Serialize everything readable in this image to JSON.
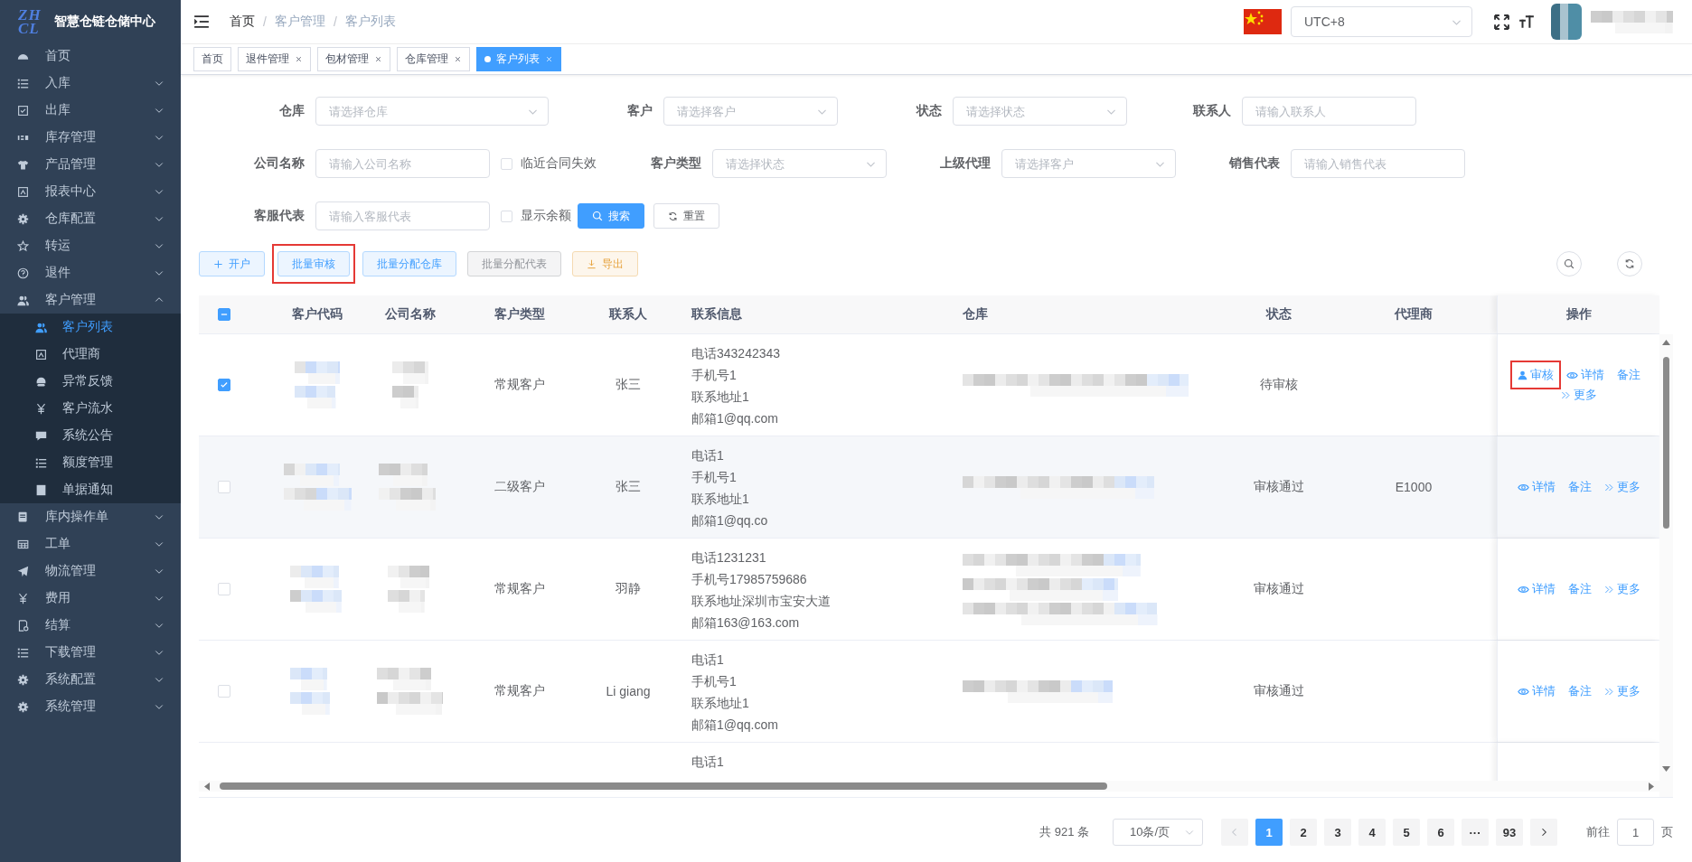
{
  "sidebar": {
    "logo_text": "ZHCL",
    "title": "智慧仓链仓储中心",
    "items": [
      {
        "label": "首页",
        "expandable": false,
        "selected": false
      },
      {
        "label": "入库",
        "expandable": true,
        "expanded": false,
        "selected": false
      },
      {
        "label": "出库",
        "expandable": true,
        "expanded": false,
        "selected": false
      },
      {
        "label": "库存管理",
        "expandable": true,
        "expanded": false,
        "selected": false
      },
      {
        "label": "产品管理",
        "expandable": true,
        "expanded": false,
        "selected": false
      },
      {
        "label": "报表中心",
        "expandable": true,
        "expanded": false,
        "selected": false
      },
      {
        "label": "仓库配置",
        "expandable": true,
        "expanded": false,
        "selected": false
      },
      {
        "label": "转运",
        "expandable": true,
        "expanded": false,
        "selected": false
      },
      {
        "label": "退件",
        "expandable": true,
        "expanded": false,
        "selected": false
      },
      {
        "label": "客户管理",
        "expandable": true,
        "expanded": true,
        "selected": false,
        "children": [
          {
            "label": "客户列表",
            "selected": true
          },
          {
            "label": "代理商",
            "selected": false
          },
          {
            "label": "异常反馈",
            "selected": false
          },
          {
            "label": "客户流水",
            "selected": false
          },
          {
            "label": "系统公告",
            "selected": false
          },
          {
            "label": "额度管理",
            "selected": false
          },
          {
            "label": "单据通知",
            "selected": false
          }
        ]
      },
      {
        "label": "库内操作单",
        "expandable": true,
        "expanded": false,
        "selected": false
      },
      {
        "label": "工单",
        "expandable": true,
        "expanded": false,
        "selected": false
      },
      {
        "label": "物流管理",
        "expandable": true,
        "expanded": false,
        "selected": false
      },
      {
        "label": "费用",
        "expandable": true,
        "expanded": false,
        "selected": false
      },
      {
        "label": "结算",
        "expandable": true,
        "expanded": false,
        "selected": false
      },
      {
        "label": "下载管理",
        "expandable": true,
        "expanded": false,
        "selected": false
      },
      {
        "label": "系统配置",
        "expandable": true,
        "expanded": false,
        "selected": false
      },
      {
        "label": "系统管理",
        "expandable": true,
        "expanded": false,
        "selected": false
      }
    ]
  },
  "header": {
    "separator": "/",
    "breadcrumb": [
      {
        "label": "首页",
        "link": true
      },
      {
        "label": "客户管理",
        "link": false
      },
      {
        "label": "客户列表",
        "link": false
      }
    ],
    "timezone": "UTC+8"
  },
  "tags": [
    {
      "label": "首页",
      "closable": false,
      "selected": false
    },
    {
      "label": "退件管理",
      "closable": true,
      "selected": false
    },
    {
      "label": "包材管理",
      "closable": true,
      "selected": false
    },
    {
      "label": "仓库管理",
      "closable": true,
      "selected": false
    },
    {
      "label": "客户列表",
      "closable": true,
      "selected": true
    }
  ],
  "filters": {
    "rows": [
      [
        {
          "kind": "select",
          "label": "仓库",
          "placeholder": "请选择仓库"
        },
        {
          "kind": "select",
          "label": "客户",
          "placeholder": "请选择客户"
        },
        {
          "kind": "select",
          "label": "状态",
          "placeholder": "请选择状态"
        },
        {
          "kind": "input",
          "label": "联系人",
          "placeholder": "请输入联系人"
        }
      ],
      [
        {
          "kind": "input",
          "label": "公司名称",
          "placeholder": "请输入公司名称",
          "checkbox": {
            "label": "临近合同失效",
            "checked": false
          }
        },
        {
          "kind": "select",
          "label": "客户类型",
          "placeholder": "请选择状态"
        },
        {
          "kind": "select",
          "label": "上级代理",
          "placeholder": "请选择客户"
        },
        {
          "kind": "input",
          "label": "销售代表",
          "placeholder": "请输入销售代表"
        }
      ],
      [
        {
          "kind": "input",
          "label": "客服代表",
          "placeholder": "请输入客服代表",
          "checkbox": {
            "label": "显示余额",
            "checked": false
          }
        },
        {
          "kind": "buttons",
          "buttons": [
            {
              "kind": "search",
              "label": "搜索"
            },
            {
              "kind": "reset",
              "label": "重置"
            }
          ]
        }
      ]
    ]
  },
  "toolbar": {
    "buttons": [
      {
        "kind": "create",
        "label": "开户",
        "highlighted": false
      },
      {
        "kind": "batch",
        "label": "批量审核",
        "highlighted": true
      },
      {
        "kind": "batch",
        "label": "批量分配仓库",
        "highlighted": false
      },
      {
        "kind": "muted",
        "label": "批量分配代表",
        "highlighted": false
      },
      {
        "kind": "export",
        "label": "导出",
        "highlighted": false
      }
    ]
  },
  "table": {
    "columns": [
      "客户代码",
      "公司名称",
      "客户类型",
      "联系人",
      "联系信息",
      "仓库",
      "状态",
      "代理商",
      "操作"
    ],
    "select_all": {
      "indeterminate": true
    },
    "rows": [
      {
        "selected": true,
        "hovered": false,
        "blurred": true,
        "type": "常规客户",
        "contact": "张三",
        "contact_info": [
          "电话343242343",
          "手机号1",
          "联系地址1",
          "邮箱1@qq.com"
        ],
        "status": "待审核",
        "actions": [
          {
            "kind": "audit",
            "label": "审核",
            "highlighted": true
          },
          {
            "kind": "detail",
            "label": "详情",
            "highlighted": false
          },
          {
            "kind": "note",
            "label": "备注",
            "highlighted": false
          },
          {
            "kind": "more",
            "label": "更多",
            "highlighted": false
          }
        ]
      },
      {
        "selected": false,
        "hovered": true,
        "blurred": true,
        "type": "二级客户",
        "contact": "张三",
        "contact_info": [
          "电话1",
          "手机号1",
          "联系地址1",
          "邮箱1@qq.co"
        ],
        "status": "审核通过",
        "agent": "E1000",
        "actions": [
          {
            "kind": "detail",
            "label": "详情",
            "highlighted": false
          },
          {
            "kind": "note",
            "label": "备注",
            "highlighted": false
          },
          {
            "kind": "more",
            "label": "更多",
            "highlighted": false
          }
        ]
      },
      {
        "selected": false,
        "hovered": false,
        "blurred": true,
        "type": "常规客户",
        "contact": "羽静",
        "contact_info": [
          "电话1231231",
          "手机号17985759686",
          "联系地址深圳市宝安大道",
          "邮箱163@163.com"
        ],
        "status": "审核通过",
        "actions": [
          {
            "kind": "detail",
            "label": "详情",
            "highlighted": false
          },
          {
            "kind": "note",
            "label": "备注",
            "highlighted": false
          },
          {
            "kind": "more",
            "label": "更多",
            "highlighted": false
          }
        ]
      },
      {
        "selected": false,
        "hovered": false,
        "blurred": true,
        "type": "常规客户",
        "contact": "Li giang",
        "contact_info": [
          "电话1",
          "手机号1",
          "联系地址1",
          "邮箱1@qq.com"
        ],
        "status": "审核通过",
        "actions": [
          {
            "kind": "detail",
            "label": "详情",
            "highlighted": false
          },
          {
            "kind": "note",
            "label": "备注",
            "highlighted": false
          },
          {
            "kind": "more",
            "label": "更多",
            "highlighted": false
          }
        ]
      },
      {
        "contact_info": [
          "电话1"
        ]
      }
    ]
  },
  "pagination": {
    "total": "共 921 条",
    "page_size": "10条/页",
    "pages": [
      {
        "label": "1",
        "selected": true
      },
      {
        "label": "2",
        "selected": false
      },
      {
        "label": "3",
        "selected": false
      },
      {
        "label": "4",
        "selected": false
      },
      {
        "label": "5",
        "selected": false
      },
      {
        "label": "6",
        "selected": false
      },
      {
        "label": "···",
        "selected": false
      },
      {
        "label": "93",
        "selected": false
      }
    ],
    "goto_label": "前往",
    "goto_value": "1",
    "page_suffix": "页"
  }
}
